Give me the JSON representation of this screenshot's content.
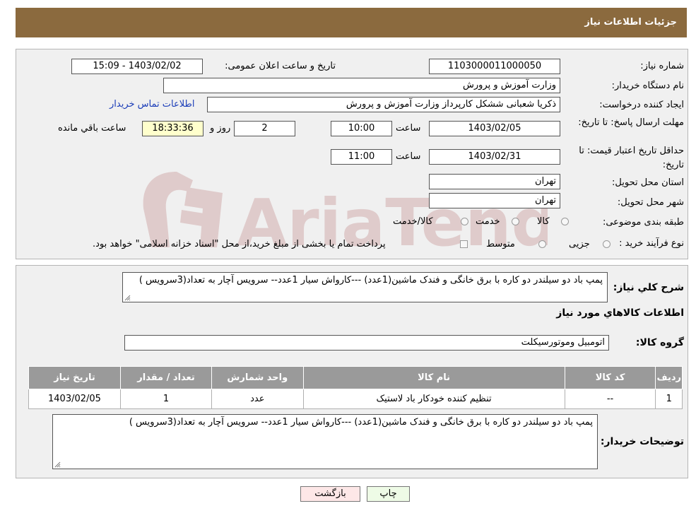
{
  "header": {
    "title": "جزئیات اطلاعات نیاز"
  },
  "form": {
    "need_number_label": "شماره نیاز:",
    "need_number": "1103000011000050",
    "announce_label": "تاریخ و ساعت اعلان عمومی:",
    "announce_value": "1403/02/02 - 15:09",
    "buyer_org_label": "نام دستگاه خریدار:",
    "buyer_org": "وزارت آموزش و پرورش",
    "creator_label": "ایجاد کننده درخواست:",
    "creator": "ذکریا شعبانی ششکل کارپرداز وزارت آموزش و پرورش",
    "contact_link": "اطلاعات تماس خریدار",
    "deadline_label": "مهلت ارسال پاسخ: تا تاریخ:",
    "deadline_date": "1403/02/05",
    "time_label": "ساعت",
    "deadline_time": "10:00",
    "days_value": "2",
    "days_label": "روز و",
    "remaining_time": "18:33:36",
    "remaining_label": "ساعت باقي مانده",
    "validity_label": "حداقل تاریخ اعتبار قیمت: تا تاریخ:",
    "validity_date": "1403/02/31",
    "validity_time": "11:00",
    "province_label": "استان محل تحویل:",
    "province": "تهران",
    "city_label": "شهر محل تحویل:",
    "city": "تهران",
    "category_label": "طبقه بندی موضوعی:",
    "category_options": [
      "کالا",
      "خدمت",
      "کالا/خدمت"
    ],
    "process_label": "نوع فرآیند خرید :",
    "process_options": [
      "جزیی",
      "متوسط"
    ],
    "process_note": "پرداخت تمام یا بخشی از مبلغ خرید،از محل \"اسناد خزانه اسلامی\" خواهد بود."
  },
  "watermark": {
    "text": "AriaTender.neT"
  },
  "details": {
    "summary_label": "شرح کلي نياز:",
    "summary": "پمپ باد دو سیلندر دو کاره با برق خانگی و فندک ماشین(1عدد) ---کارواش سیار 1عدد-- سرویس آچار به تعداد(3سرویس )",
    "items_title": "اطلاعات کالاهاي مورد نياز",
    "group_label": "گروه کالا:",
    "group_value": "اتومبیل وموتورسیکلت",
    "table": {
      "headers": [
        "رديف",
        "کد کالا",
        "نام کالا",
        "واحد شمارش",
        "تعداد / مقدار",
        "تاریخ نیاز"
      ],
      "rows": [
        [
          "1",
          "--",
          "تنظیم کننده خودکار باد لاستیک",
          "عدد",
          "1",
          "1403/02/05"
        ]
      ]
    },
    "buyer_notes_label": "توضیحات خریدار:",
    "buyer_notes": "پمپ باد دو سیلندر دو کاره با برق خانگی و فندک ماشین(1عدد) ---کارواش سیار 1عدد-- سرویس آچار به تعداد(3سرویس )"
  },
  "buttons": {
    "print": "چاپ",
    "back": "بازگشت"
  }
}
